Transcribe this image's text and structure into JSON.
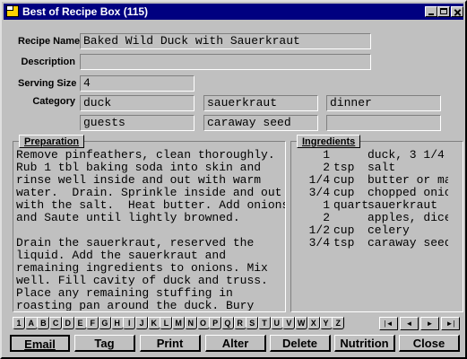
{
  "window": {
    "title": "Best of Recipe Box (115)"
  },
  "form": {
    "recipe_name_label": "Recipe Name",
    "recipe_name": "Baked Wild Duck with Sauerkraut",
    "description_label": "Description",
    "description": "",
    "serving_size_label": "Serving Size",
    "serving_size": "4",
    "category_label": "Category",
    "categories": [
      "duck",
      "sauerkraut",
      "dinner",
      "guests",
      "caraway seed",
      ""
    ]
  },
  "preparation": {
    "label": "Preparation",
    "text": "Remove pinfeathers, clean thoroughly.\nRub 1 tbl baking soda into skin and\nrinse well inside and out with warm\nwater.  Drain. Sprinkle inside and out\nwith the salt.  Heat butter. Add onions\nand Saute until lightly browned.\n\nDrain the sauerkraut, reserved the\nliquid. Add the sauerkraut and\nremaining ingredients to onions. Mix\nwell. Fill cavity of duck and truss.\nPlace any remaining stuffing in\nroasting pan around the duck. Bury"
  },
  "ingredients": {
    "label": "Ingredients",
    "items": [
      {
        "qty": "1",
        "unit": "",
        "name": "duck, 3 1/4"
      },
      {
        "qty": "2",
        "unit": "tsp",
        "name": "salt"
      },
      {
        "qty": "1/4",
        "unit": "cup",
        "name": "butter or ma"
      },
      {
        "qty": "3/4",
        "unit": "cup",
        "name": "chopped onio"
      },
      {
        "qty": "1",
        "unit": "quart",
        "name": "sauerkraut"
      },
      {
        "qty": "2",
        "unit": "",
        "name": "apples, dice"
      },
      {
        "qty": "1/2",
        "unit": "cup",
        "name": "celery"
      },
      {
        "qty": "3/4",
        "unit": "tsp",
        "name": "caraway seed"
      }
    ]
  },
  "index_tabs": [
    "1",
    "A",
    "B",
    "C",
    "D",
    "E",
    "F",
    "G",
    "H",
    "I",
    "J",
    "K",
    "L",
    "M",
    "N",
    "O",
    "P",
    "Q",
    "R",
    "S",
    "T",
    "U",
    "V",
    "W",
    "X",
    "Y",
    "Z"
  ],
  "navigation": {
    "first": "|◄",
    "prev": "◄",
    "next": "►",
    "last": "►|"
  },
  "actions": {
    "email": "Email",
    "tag": "Tag",
    "print": "Print",
    "alter": "Alter",
    "delete": "Delete",
    "nutrition": "Nutrition",
    "close": "Close"
  }
}
